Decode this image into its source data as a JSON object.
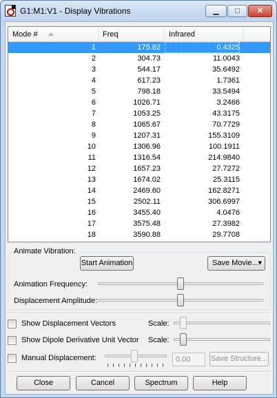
{
  "window": {
    "title": "G1:M1:V1 - Display Vibrations"
  },
  "table": {
    "headers": {
      "mode": "Mode #",
      "freq": "Freq",
      "infrared": "Infrared"
    },
    "rows": [
      {
        "mode": "1",
        "freq": "175.82",
        "ir": "0.4325"
      },
      {
        "mode": "2",
        "freq": "304.73",
        "ir": "11.0043"
      },
      {
        "mode": "3",
        "freq": "544.17",
        "ir": "35.6492"
      },
      {
        "mode": "4",
        "freq": "617.23",
        "ir": "1.7361"
      },
      {
        "mode": "5",
        "freq": "798.18",
        "ir": "33.5494"
      },
      {
        "mode": "6",
        "freq": "1026.71",
        "ir": "3.2466"
      },
      {
        "mode": "7",
        "freq": "1053.25",
        "ir": "43.3175"
      },
      {
        "mode": "8",
        "freq": "1065.67",
        "ir": "70.7729"
      },
      {
        "mode": "9",
        "freq": "1207.31",
        "ir": "155.3109"
      },
      {
        "mode": "10",
        "freq": "1306.96",
        "ir": "100.1911"
      },
      {
        "mode": "11",
        "freq": "1316.54",
        "ir": "214.9840"
      },
      {
        "mode": "12",
        "freq": "1657.23",
        "ir": "27.7272"
      },
      {
        "mode": "13",
        "freq": "1674.02",
        "ir": "25.3115"
      },
      {
        "mode": "14",
        "freq": "2469.60",
        "ir": "162.8271"
      },
      {
        "mode": "15",
        "freq": "2502.11",
        "ir": "306.6997"
      },
      {
        "mode": "16",
        "freq": "3455.40",
        "ir": "4.0476"
      },
      {
        "mode": "17",
        "freq": "3575.48",
        "ir": "27.3982"
      },
      {
        "mode": "18",
        "freq": "3590.88",
        "ir": "29.7708"
      }
    ]
  },
  "animate": {
    "group_title": "Animate Vibration:",
    "start_button": "Start Animation",
    "save_movie_button": "Save Movie...",
    "frequency_label": "Animation Frequency:",
    "frequency_level": 0.5,
    "amplitude_label": "Displacement Amplitude:",
    "amplitude_level": 0.5
  },
  "options": {
    "displacement_vectors": "Show Displacement Vectors",
    "dipole_vector": "Show Dipole Derivative Unit Vector",
    "scale_label": "Scale:",
    "manual_displacement": "Manual Displacement:",
    "manual_value": "0.00",
    "save_structure": "Save Structure..."
  },
  "footer": {
    "close": "Close",
    "cancel": "Cancel",
    "spectrum": "Spectrum",
    "help": "Help"
  }
}
